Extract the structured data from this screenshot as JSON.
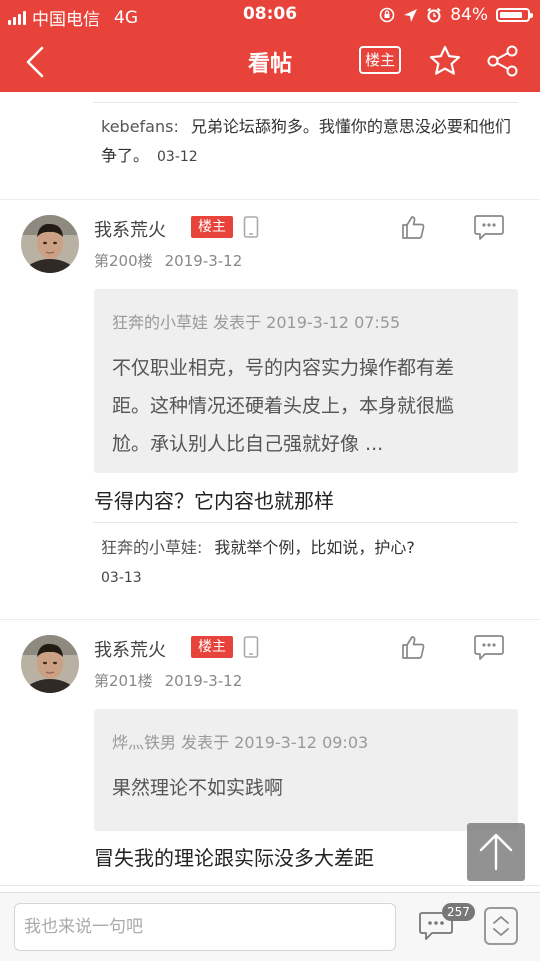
{
  "status_bar": {
    "carrier": "中国电信",
    "network": "4G",
    "time": "08:06",
    "battery_text": "84%",
    "battery_level": 0.84
  },
  "nav": {
    "title": "看帖",
    "louzhu_label": "楼主",
    "back_icon": "chevron-left-icon",
    "star_icon": "star-icon",
    "share_icon": "share-icon"
  },
  "top_reply": {
    "author": "kebefans:",
    "text": "兄弟论坛舔狗多。我懂你的意思没必要和他们争了。",
    "date": "03-12"
  },
  "posts": [
    {
      "username": "我系荒火",
      "badge": "楼主",
      "floor": "第200楼",
      "date": "2019-3-12",
      "quote_head": "狂奔的小草娃 发表于 2019-3-12 07:55",
      "quote_lines": [
        "不仅职业相克，号的内容实力操作都有差",
        "距。这种情况还硬着头皮上，本身就很尴",
        "尬。承认别人比自己强就好像 ..."
      ],
      "text": "号得内容？它内容也就那样",
      "reply": {
        "author": "狂奔的小草娃:",
        "text": "我就举个例，比如说，护心?",
        "date": "03-13"
      }
    },
    {
      "username": "我系荒火",
      "badge": "楼主",
      "floor": "第201楼",
      "date": "2019-3-12",
      "quote_head": "烨灬铁男 发表于 2019-3-12 09:03",
      "quote_lines": [
        "果然理论不如实践啊"
      ],
      "text": "冒失我的理论跟实际没多大差距"
    }
  ],
  "bottom_bar": {
    "input_placeholder": "我也来说一句吧",
    "comment_count": "257"
  },
  "colors": {
    "accent": "#e8433b",
    "quote_bg": "#efefef"
  }
}
